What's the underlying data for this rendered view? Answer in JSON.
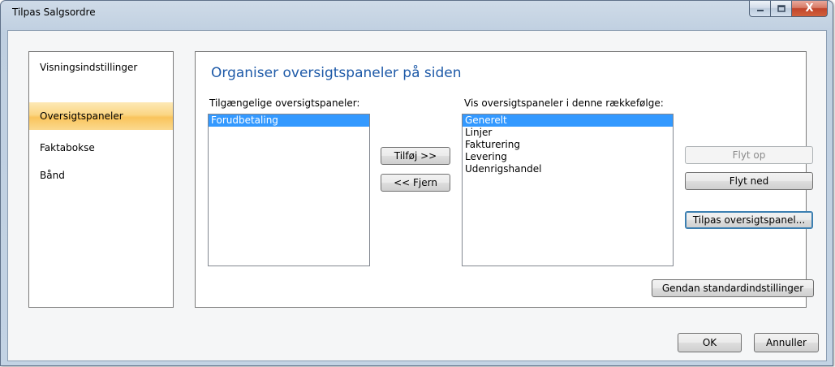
{
  "window": {
    "title": "Tilpas Salgsordre",
    "controls": {
      "minimize": "–",
      "maximize": "▢",
      "close": "X"
    }
  },
  "nav": {
    "items": [
      {
        "label": "Visningsindstillinger"
      },
      {
        "label": "Oversigtspaneler"
      },
      {
        "label": "Faktabokse"
      },
      {
        "label": "Bånd"
      }
    ],
    "selected": "Oversigtspaneler"
  },
  "content": {
    "heading": "Organiser oversigtspaneler på siden",
    "available_label": "Tilgængelige oversigtspaneler:",
    "available_items": [
      "Forudbetaling"
    ],
    "shown_label": "Vis oversigtspaneler i denne rækkefølge:",
    "shown_items": [
      "Generelt",
      "Linjer",
      "Fakturering",
      "Levering",
      "Udenrigshandel"
    ],
    "add_button": "Tilføj >>",
    "remove_button": "<< Fjern",
    "move_up_button": "Flyt op",
    "move_down_button": "Flyt ned",
    "customize_button": "Tilpas oversigtspanel...",
    "restore_button": "Gendan standardindstillinger"
  },
  "footer": {
    "ok_button": "OK",
    "cancel_button": "Annuller"
  },
  "colors": {
    "selection": "#3399ff",
    "nav_selected": "#f9c45c",
    "heading": "#1e5aa8"
  }
}
